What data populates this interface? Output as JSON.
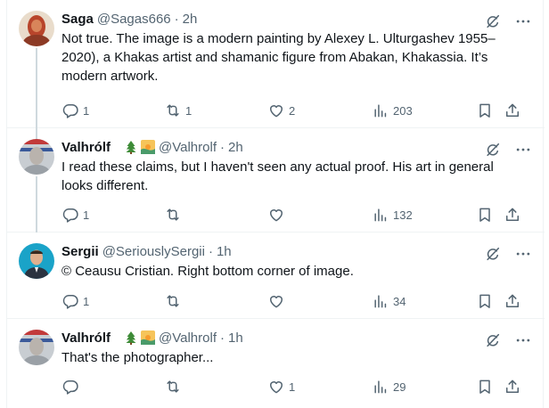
{
  "tweets": [
    {
      "name": "Saga",
      "handle": "@Sagas666",
      "time": "2h",
      "text": "Not true. The image is a modern painting by Alexey L. Ulturgashev 1955–2020), a Khakas artist and shamanic figure from Abakan, Khakassia. It’s modern artwork.",
      "replies": "1",
      "reposts": "1",
      "likes": "2",
      "views": "203"
    },
    {
      "name": "Valhrólf",
      "emoji": [
        "tree-emoji",
        "sunrise-emoji"
      ],
      "handle": "@Valhrolf",
      "time": "2h",
      "text": "I read these claims, but I haven't seen any actual proof. His art in general looks different.",
      "replies": "1",
      "reposts": "",
      "likes": "",
      "views": "132"
    },
    {
      "name": "Sergii",
      "handle": "@SeriouslySergii",
      "time": "1h",
      "text": "© Ceausu Cristian. Right bottom corner of image.",
      "replies": "1",
      "reposts": "",
      "likes": "",
      "views": "34"
    },
    {
      "name": "Valhrólf",
      "emoji": [
        "tree-emoji",
        "sunrise-emoji"
      ],
      "handle": "@Valhrolf",
      "time": "1h",
      "text": "That's the photographer...",
      "replies": "",
      "reposts": "",
      "likes": "1",
      "views": "29"
    }
  ],
  "separator": "·",
  "colors": {
    "text": "#0f1419",
    "muted": "#536471",
    "border": "#eff3f4",
    "thread": "#cfd9de"
  }
}
